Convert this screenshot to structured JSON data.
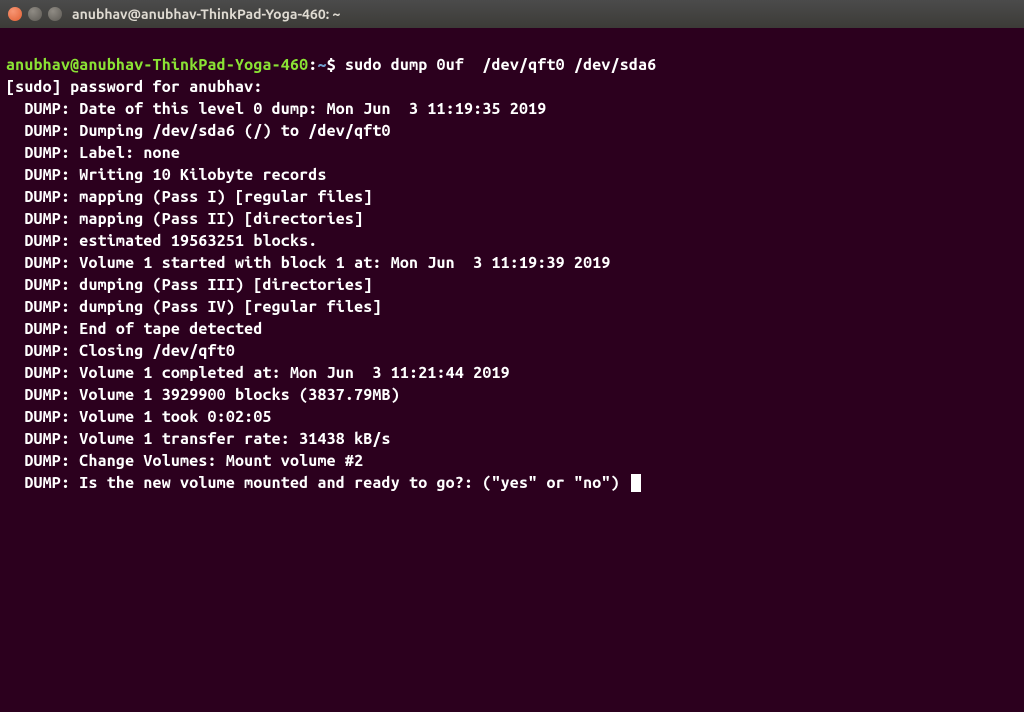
{
  "window": {
    "title": "anubhav@anubhav-ThinkPad-Yoga-460: ~"
  },
  "prompt": {
    "userhost": "anubhav@anubhav-ThinkPad-Yoga-460",
    "sep": ":",
    "path": "~",
    "end": "$ "
  },
  "command": "sudo dump 0uf  /dev/qft0 /dev/sda6",
  "lines": [
    "[sudo] password for anubhav:",
    "  DUMP: Date of this level 0 dump: Mon Jun  3 11:19:35 2019",
    "  DUMP: Dumping /dev/sda6 (/) to /dev/qft0",
    "  DUMP: Label: none",
    "  DUMP: Writing 10 Kilobyte records",
    "  DUMP: mapping (Pass I) [regular files]",
    "  DUMP: mapping (Pass II) [directories]",
    "  DUMP: estimated 19563251 blocks.",
    "  DUMP: Volume 1 started with block 1 at: Mon Jun  3 11:19:39 2019",
    "  DUMP: dumping (Pass III) [directories]",
    "  DUMP: dumping (Pass IV) [regular files]",
    "  DUMP: End of tape detected",
    "  DUMP: Closing /dev/qft0",
    "  DUMP: Volume 1 completed at: Mon Jun  3 11:21:44 2019",
    "  DUMP: Volume 1 3929900 blocks (3837.79MB)",
    "  DUMP: Volume 1 took 0:02:05",
    "  DUMP: Volume 1 transfer rate: 31438 kB/s",
    "  DUMP: Change Volumes: Mount volume #2",
    "  DUMP: Is the new volume mounted and ready to go?: (\"yes\" or \"no\") "
  ]
}
